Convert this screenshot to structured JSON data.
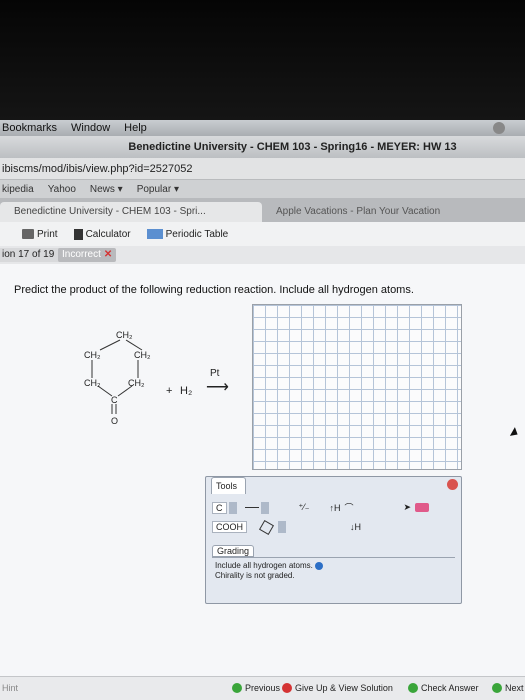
{
  "menubar": {
    "items": [
      "Bookmarks",
      "Window",
      "Help"
    ]
  },
  "window": {
    "title": "Benedictine University - CHEM 103 - Spring16 - MEYER: HW 13"
  },
  "address": {
    "url": "ibiscms/mod/ibis/view.php?id=2527052"
  },
  "bookmarks": {
    "items": [
      "kipedia",
      "Yahoo",
      "News ▾",
      "Popular ▾"
    ]
  },
  "tabs": [
    {
      "label": "Benedictine University - CHEM 103 - Spri..."
    },
    {
      "label": "Apple Vacations - Plan Your Vacation"
    }
  ],
  "toolbar": {
    "print": "Print",
    "calculator": "Calculator",
    "periodic_table": "Periodic Table"
  },
  "question": {
    "number": "ion 17 of 19",
    "status": "Incorrect"
  },
  "prompt": "Predict the product of the following reduction reaction. Include all hydrogen atoms.",
  "reaction": {
    "ch2_top": "CH₂",
    "ch2_ul": "CH₂",
    "ch2_ur": "CH₂",
    "ch2_ll": "CH₂",
    "ch2_lr": "CH₂",
    "carbon": "C",
    "oxygen": "O",
    "plus": "+",
    "reagent": "H₂",
    "catalyst": "Pt",
    "arrow": "⟶"
  },
  "tools": {
    "label": "Tools",
    "carbon": "C",
    "cooh": "COOH",
    "charge": "⁺⁄₋",
    "add_h": "↑H",
    "remove_h": "↓H"
  },
  "grading": {
    "label": "Grading",
    "line1": "Include all hydrogen atoms.",
    "line2": "Chirality is not graded."
  },
  "footer": {
    "hint": "Hint",
    "previous": "Previous",
    "give_up": "Give Up & View Solution",
    "check": "Check Answer",
    "next": "Next"
  },
  "colors": {
    "incorrect": "#d43333",
    "grid": "#b5c4d8",
    "ok": "#3aa53a",
    "nav": "#2d6fc6"
  }
}
